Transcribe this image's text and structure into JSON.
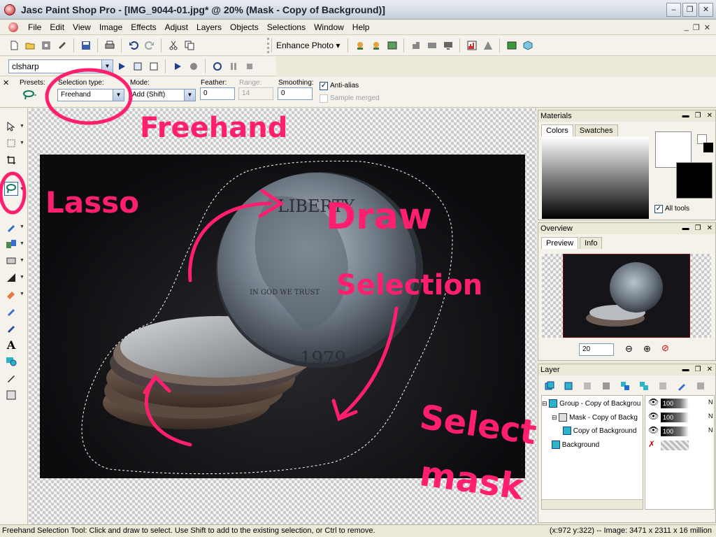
{
  "window": {
    "title": "Jasc Paint Shop Pro - [IMG_9044-01.jpg* @  20% (Mask - Copy of Background)]",
    "minimize": "–",
    "maximize": "❐",
    "close": "✕"
  },
  "menu": {
    "items": [
      "File",
      "Edit",
      "View",
      "Image",
      "Effects",
      "Adjust",
      "Layers",
      "Objects",
      "Selections",
      "Window",
      "Help"
    ],
    "mdi_minimize": "_",
    "mdi_restore": "❐",
    "mdi_close": "✕"
  },
  "toolbar": {
    "enhance_photo": "Enhance Photo ▾",
    "script_name": "clsharp"
  },
  "tool_options": {
    "presets_label": "Presets:",
    "selection_type_label": "Selection type:",
    "selection_type_value": "Freehand",
    "mode_label": "Mode:",
    "mode_value": "Add (Shift)",
    "feather_label": "Feather:",
    "feather_value": "0",
    "range_label": "Range:",
    "range_value": "14",
    "smoothing_label": "Smoothing:",
    "smoothing_value": "0",
    "antialias_label": "Anti-alias",
    "antialias_checked": true,
    "sample_merged_label": "Sample merged",
    "sample_merged_checked": false
  },
  "materials": {
    "title": "Materials",
    "tab_colors": "Colors",
    "tab_swatches": "Swatches",
    "all_tools_label": "All tools",
    "foreground_color": "#ffffff",
    "background_color": "#000000"
  },
  "overview": {
    "title": "Overview",
    "tab_preview": "Preview",
    "tab_info": "Info",
    "zoom_value": "20"
  },
  "layers": {
    "title": "Layer",
    "rows": [
      {
        "name": "Group - Copy of Backgrou",
        "opacity": "100",
        "blend": "N"
      },
      {
        "name": "Mask - Copy of Backg",
        "opacity": "100",
        "blend": "N"
      },
      {
        "name": "Copy of Background",
        "opacity": "100",
        "blend": "N"
      },
      {
        "name": "Background",
        "opacity": "",
        "blend": ""
      }
    ]
  },
  "status": {
    "left": "Freehand Selection Tool: Click and draw to select. Use Shift to add to the existing selection, or Ctrl to remove.",
    "right": "(x:972 y:322) -- Image:  3471 x 2311 x 16 million"
  },
  "annotations": {
    "freehand": "Freehand",
    "lasso": "Lasso",
    "draw_1": "Draw",
    "draw_2": "Selection",
    "select_1": "Select",
    "select_2": "mask",
    "color": "#ff1f6e"
  },
  "coin": {
    "text_liberty": "LIBERTY",
    "text_trust": "IN GOD WE TRUST",
    "year": "1979"
  }
}
